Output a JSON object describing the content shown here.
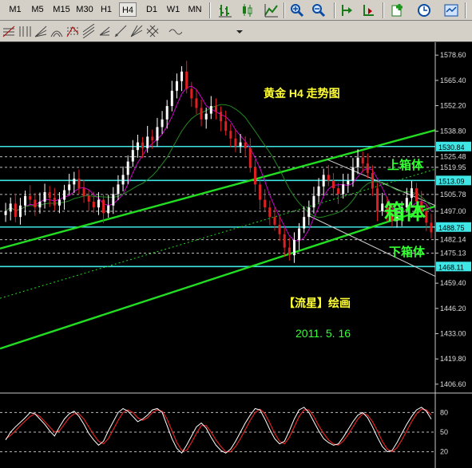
{
  "toolbar": {
    "timeframes": [
      "M1",
      "M5",
      "M15",
      "M30",
      "H1",
      "H4",
      "D1",
      "W1",
      "MN"
    ],
    "active_timeframe": "H4",
    "icons": [
      "bar-chart-icon",
      "candlestick-chart-icon",
      "line-chart-icon",
      "zoom-in-icon",
      "zoom-out-icon",
      "chart-shift-icon",
      "autoscroll-icon",
      "new-indicator-icon",
      "period-clock-icon",
      "templates-icon"
    ]
  },
  "toolbar2": {
    "icons": [
      "fibonacci-retracement-icon",
      "fibonacci-time-zones-icon",
      "fibonacci-fan-icon",
      "fibonacci-arcs-icon",
      "fibonacci-expansion-icon",
      "fibonacci-channel-icon",
      "andrews-pitchfork-icon",
      "gann-line-icon",
      "gann-fan-icon",
      "gann-grid-icon",
      "cycle-lines-icon",
      "drawing-more-icon"
    ]
  },
  "annotations": {
    "title": "黄金  H4  走势图",
    "upper_box": "上箱体",
    "box": "箱体",
    "lower_box": "下箱体",
    "author": "【流星】绘画",
    "date": "2011. 5. 16"
  },
  "colors": {
    "background": "#000000",
    "bull_candle": "#ffffff",
    "bear_candle": "#e02020",
    "support_resistance": "#3ee6e6",
    "channel": "#22dd22",
    "annotation_yellow": "#ffff33",
    "annotation_green": "#33ff33",
    "stoch_main": "#ffffff",
    "stoch_signal": "#dd2222",
    "ma_fast": "#cc00cc",
    "ma_slow": "#228822"
  },
  "chart_data": {
    "type": "candlestick",
    "symbol": "Gold",
    "timeframe": "H4",
    "y_ticks": [
      1578.6,
      1565.4,
      1552.2,
      1538.8,
      1525.48,
      1519.95,
      1505.78,
      1497.0,
      1482.14,
      1475.13,
      1459.4,
      1446.2,
      1433.0,
      1419.8,
      1406.6
    ],
    "price_labels": {
      "1530.84": "1530.84",
      "1513.09": "1513.09",
      "1488.75": "1488.75",
      "1468.11": "1468.11"
    },
    "horizontal_levels": [
      {
        "value": 1530.84,
        "style": "solid",
        "label": "1530.84"
      },
      {
        "value": 1525.48,
        "style": "dashed"
      },
      {
        "value": 1519.95,
        "style": "dashed"
      },
      {
        "value": 1513.09,
        "style": "solid",
        "label": "1513.09"
      },
      {
        "value": 1505.78,
        "style": "dashed"
      },
      {
        "value": 1497.0,
        "style": "dashed"
      },
      {
        "value": 1488.75,
        "style": "solid",
        "label": "1488.75"
      },
      {
        "value": 1482.14,
        "style": "dashed"
      },
      {
        "value": 1475.13,
        "style": "dashed"
      },
      {
        "value": 1468.11,
        "style": "solid",
        "label": "1468.11"
      }
    ],
    "ylim": [
      1402.8,
      1582.0
    ],
    "close": [
      1497,
      1501,
      1494,
      1500,
      1505,
      1503,
      1499,
      1502,
      1507,
      1504,
      1500,
      1503,
      1508,
      1511,
      1514,
      1509,
      1505,
      1502,
      1499,
      1503,
      1496,
      1500,
      1506,
      1511,
      1516,
      1523,
      1529,
      1533,
      1530,
      1536,
      1534,
      1541,
      1545,
      1552,
      1560,
      1565,
      1570,
      1561,
      1556,
      1551,
      1545,
      1548,
      1552,
      1549,
      1544,
      1539,
      1535,
      1531,
      1533,
      1530,
      1520,
      1511,
      1503,
      1499,
      1494,
      1490,
      1485,
      1478,
      1474,
      1482,
      1488,
      1494,
      1499,
      1505,
      1510,
      1516,
      1513,
      1509,
      1506,
      1511,
      1513,
      1520,
      1525,
      1522,
      1517,
      1509,
      1497,
      1501,
      1496,
      1492,
      1494,
      1499,
      1504,
      1509,
      1502,
      1497,
      1491,
      1486
    ],
    "stochastic": {
      "levels": [
        80,
        50,
        20
      ],
      "main": [
        38,
        50,
        58,
        65,
        72,
        80,
        78,
        70,
        62,
        52,
        44,
        58,
        70,
        78,
        82,
        74,
        62,
        48,
        38,
        30,
        36,
        52,
        66,
        80,
        86,
        82,
        74,
        66,
        70,
        76,
        84,
        86,
        80,
        60,
        40,
        25,
        18,
        30,
        44,
        58,
        64,
        56,
        42,
        30,
        22,
        18,
        24,
        36,
        50,
        64,
        76,
        86,
        84,
        70,
        54,
        40,
        32,
        36,
        52,
        70,
        84,
        88,
        80,
        66,
        52,
        40,
        34,
        30,
        32,
        42,
        54,
        66,
        76,
        80,
        72,
        58,
        42,
        28,
        20,
        22,
        34,
        48,
        62,
        74,
        84,
        88,
        82,
        70
      ],
      "signal": [
        40,
        45,
        52,
        60,
        67,
        74,
        78,
        74,
        66,
        58,
        50,
        52,
        62,
        72,
        78,
        78,
        70,
        58,
        46,
        36,
        32,
        40,
        54,
        68,
        80,
        84,
        80,
        72,
        68,
        72,
        80,
        84,
        82,
        70,
        52,
        34,
        22,
        22,
        34,
        48,
        60,
        60,
        50,
        38,
        28,
        20,
        20,
        28,
        40,
        54,
        68,
        80,
        85,
        78,
        64,
        48,
        36,
        32,
        42,
        58,
        74,
        84,
        84,
        74,
        60,
        48,
        38,
        32,
        30,
        36,
        46,
        58,
        70,
        78,
        76,
        66,
        52,
        36,
        24,
        20,
        26,
        38,
        52,
        66,
        78,
        85,
        84,
        76
      ]
    }
  }
}
